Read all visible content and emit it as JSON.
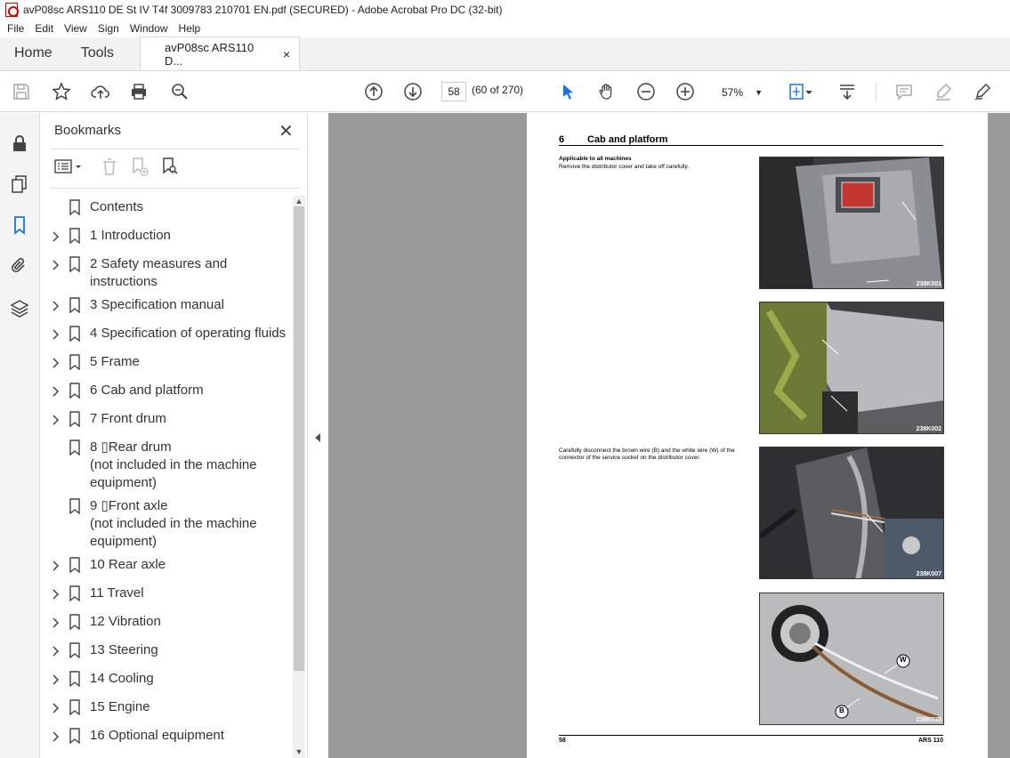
{
  "window": {
    "title": "avP08sc ARS110 DE St IV T4f 3009783 210701 EN.pdf (SECURED) - Adobe Acrobat Pro DC (32-bit)"
  },
  "menu": [
    "File",
    "Edit",
    "View",
    "Sign",
    "Window",
    "Help"
  ],
  "tabs": {
    "home": "Home",
    "tools": "Tools",
    "document": "avP08sc ARS110 D...",
    "close": "×"
  },
  "toolbar": {
    "page_number": "58",
    "page_count": "(60 of 270)",
    "zoom": "57%"
  },
  "bookmarks": {
    "title": "Bookmarks",
    "close": "✕",
    "items": [
      {
        "label": "Contents",
        "expandable": false
      },
      {
        "label": "1 Introduction",
        "expandable": true
      },
      {
        "label": "2 Safety measures and\ninstructions",
        "expandable": true
      },
      {
        "label": "3 Specification manual",
        "expandable": true
      },
      {
        "label": "4 Specification of operating fluids",
        "expandable": true
      },
      {
        "label": "5 Frame",
        "expandable": true
      },
      {
        "label": "6 Cab and platform",
        "expandable": true
      },
      {
        "label": "7 Front drum",
        "expandable": true
      },
      {
        "label": "8 ▯Rear drum\n(not included in the machine\nequipment)",
        "expandable": false
      },
      {
        "label": "9 ▯Front axle\n(not included in the machine\nequipment)",
        "expandable": false
      },
      {
        "label": "10 Rear axle",
        "expandable": true
      },
      {
        "label": "11 Travel",
        "expandable": true
      },
      {
        "label": "12 Vibration",
        "expandable": true
      },
      {
        "label": "13 Steering",
        "expandable": true
      },
      {
        "label": "14 Cooling",
        "expandable": true
      },
      {
        "label": "15 Engine",
        "expandable": true
      },
      {
        "label": "16 Optional equipment",
        "expandable": true
      }
    ]
  },
  "document_page": {
    "chapter_number": "6",
    "chapter_title": "Cab and platform",
    "section_heading": "Applicable to all machines",
    "step1": "Remove the distributor cover and take off carefully.",
    "step2": "Carefully disconnect the brown wire (B) and the white wire (W) of the connector of the service socket on the distributor cover.",
    "photo_codes": [
      "238K001",
      "238K002",
      "238K007",
      "238K033"
    ],
    "callout_w": "W",
    "callout_b": "B",
    "footer_left": "58",
    "footer_right": "ARS 110"
  }
}
